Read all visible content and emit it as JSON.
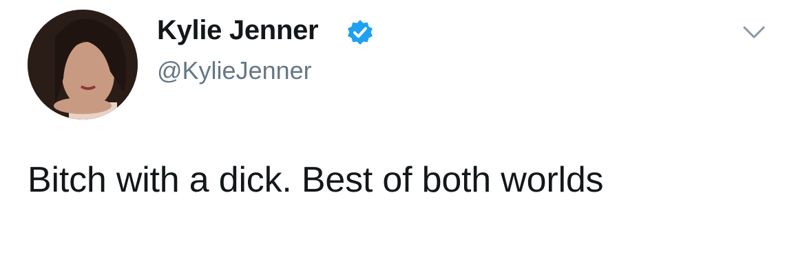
{
  "tweet": {
    "display_name": "Kylie Jenner",
    "handle": "@KylieJenner",
    "verified": true,
    "text": "Bitch with a dick. Best of both worlds",
    "icons": {
      "verified": "verified-badge-icon",
      "menu": "chevron-down-icon"
    },
    "colors": {
      "verified": "#1da1f2",
      "handle": "#657786",
      "text": "#14171a"
    }
  }
}
